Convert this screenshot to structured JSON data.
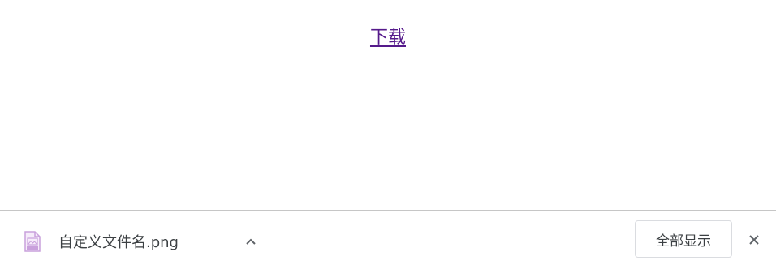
{
  "page": {
    "download_link": "下载"
  },
  "download_shelf": {
    "item": {
      "filename": "自定义文件名.png",
      "icon": "png-file-icon",
      "icon_label": "PNG"
    },
    "show_all_label": "全部显示",
    "colors": {
      "icon": "#c9a0dc",
      "link": "#551a8b"
    }
  }
}
